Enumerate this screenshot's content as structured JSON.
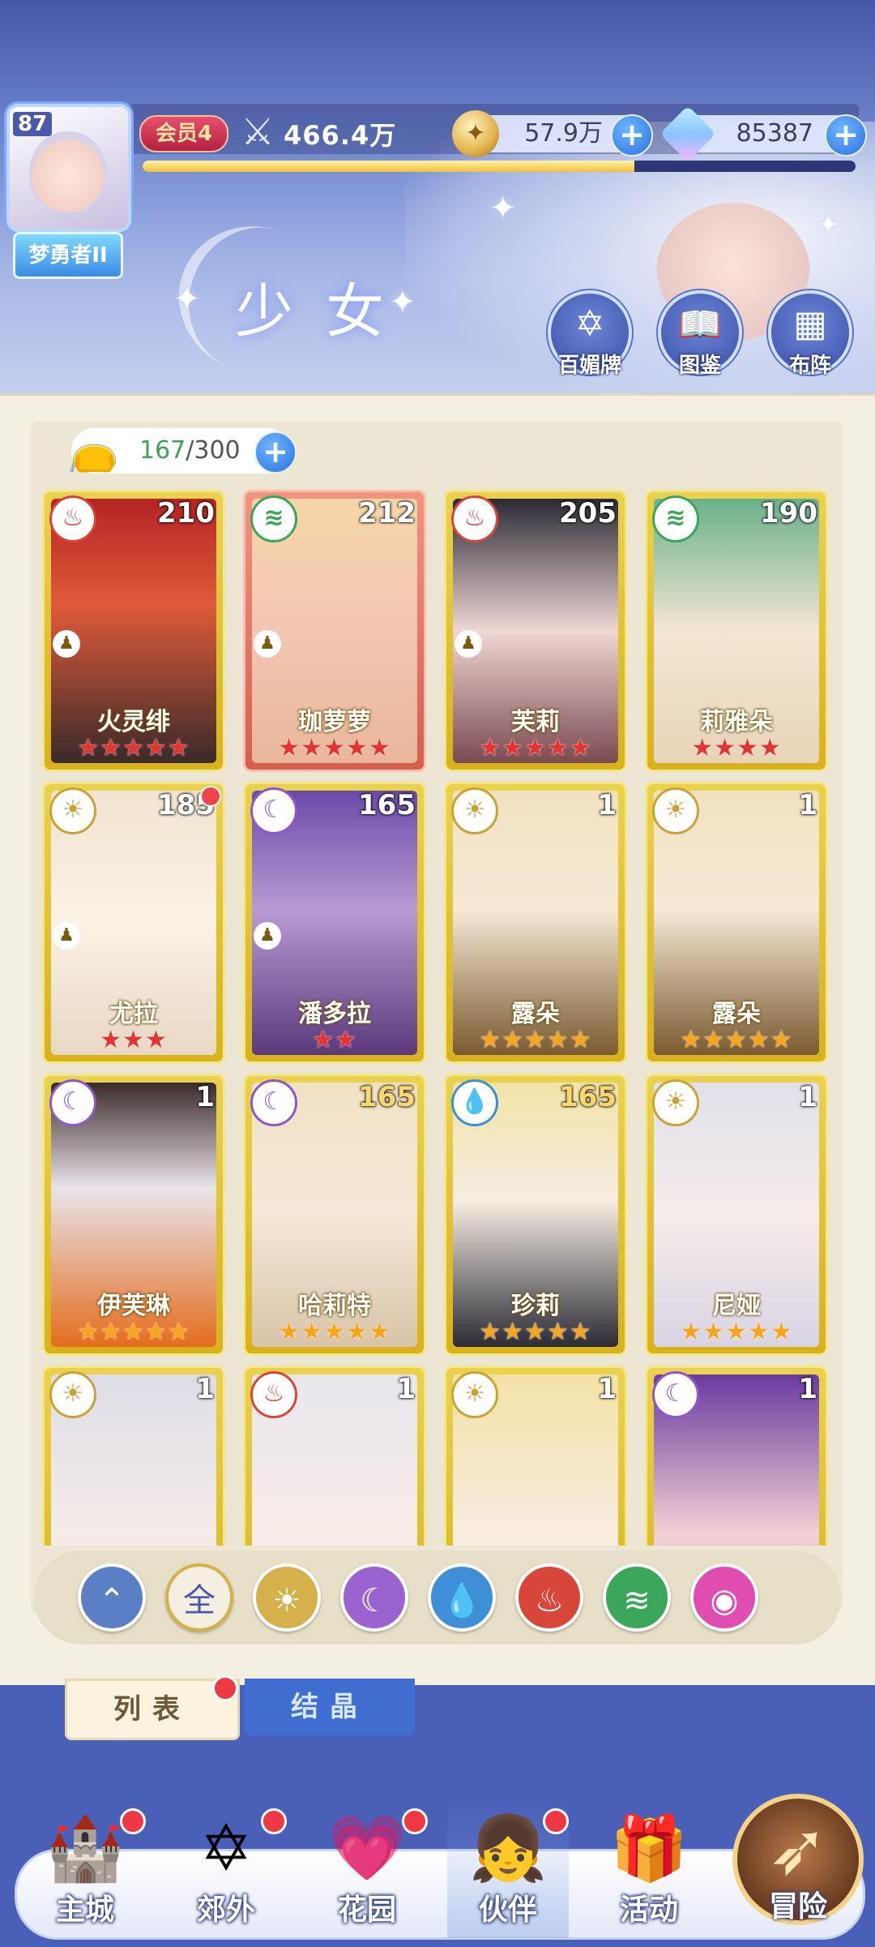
{
  "header": {
    "player_level": "87",
    "player_title": "梦勇者II",
    "vip": "会员4",
    "power": "466.4万",
    "gold": "57.9万",
    "gems": "85387",
    "exp_fraction": 0.69,
    "section_title": "少女",
    "buttons": [
      {
        "label": "百媚牌",
        "icon": "hexagram-card-icon"
      },
      {
        "label": "图鉴",
        "icon": "book-icon"
      },
      {
        "label": "布阵",
        "icon": "grid-formation-icon"
      }
    ]
  },
  "capacity": {
    "current": "167",
    "max": "/300"
  },
  "cards": [
    {
      "name": "火灵绯",
      "level": "210",
      "element": "fire",
      "stars": "★★★★★",
      "star_color": "red",
      "pink": false,
      "pawn": true,
      "dot": false
    },
    {
      "name": "珈萝萝",
      "level": "212",
      "element": "wind",
      "stars": "★★★★★",
      "star_color": "red",
      "pink": true,
      "pawn": true,
      "dot": false
    },
    {
      "name": "芙莉",
      "level": "205",
      "element": "fire",
      "stars": "★★★★★",
      "star_color": "red",
      "pink": false,
      "pawn": true,
      "dot": false
    },
    {
      "name": "莉雅朵",
      "level": "190",
      "element": "wind",
      "stars": "★★★★",
      "star_color": "red",
      "pink": false,
      "pawn": false,
      "dot": false
    },
    {
      "name": "尤拉",
      "level": "185",
      "element": "light",
      "stars": "★★★",
      "star_color": "red",
      "pink": false,
      "pawn": true,
      "dot": true
    },
    {
      "name": "潘多拉",
      "level": "165",
      "element": "moon",
      "stars": "★★",
      "star_color": "red",
      "pink": false,
      "pawn": true,
      "dot": false
    },
    {
      "name": "露朵",
      "level": "1",
      "element": "light",
      "stars": "★★★★★",
      "star_color": "gold",
      "pink": false,
      "pawn": false,
      "dot": false
    },
    {
      "name": "露朵",
      "level": "1",
      "element": "light",
      "stars": "★★★★★",
      "star_color": "gold",
      "pink": false,
      "pawn": false,
      "dot": false
    },
    {
      "name": "伊芙琳",
      "level": "1",
      "element": "moon",
      "stars": "★★★★★",
      "star_color": "gold",
      "pink": false,
      "pawn": false,
      "dot": false
    },
    {
      "name": "哈莉特",
      "level": "165",
      "element": "moon",
      "stars": "★★★★★",
      "star_color": "gold",
      "pink": false,
      "pawn": false,
      "dot": false,
      "gold_num": true
    },
    {
      "name": "珍莉",
      "level": "165",
      "element": "water",
      "stars": "★★★★★",
      "star_color": "gold",
      "pink": false,
      "pawn": false,
      "dot": false,
      "gold_num": true
    },
    {
      "name": "尼娅",
      "level": "1",
      "element": "light",
      "stars": "★★★★★",
      "star_color": "gold",
      "pink": false,
      "pawn": false,
      "dot": false
    },
    {
      "name": "",
      "level": "1",
      "element": "light",
      "stars": "",
      "star_color": "gold",
      "pink": false,
      "pawn": false,
      "dot": false
    },
    {
      "name": "",
      "level": "1",
      "element": "fire",
      "stars": "",
      "star_color": "gold",
      "pink": false,
      "pawn": false,
      "dot": false
    },
    {
      "name": "",
      "level": "1",
      "element": "light",
      "stars": "",
      "star_color": "gold",
      "pink": false,
      "pawn": false,
      "dot": false
    },
    {
      "name": "",
      "level": "1",
      "element": "moon",
      "stars": "",
      "star_color": "gold",
      "pink": false,
      "pawn": false,
      "dot": false
    }
  ],
  "filters": [
    {
      "key": "sort",
      "label": "",
      "icon": "sort-up-icon",
      "color": "#5a7fc4"
    },
    {
      "key": "all",
      "label": "全",
      "icon": "all-icon",
      "color": "#f4efe0"
    },
    {
      "key": "light",
      "label": "",
      "icon": "sun-icon",
      "color": "#d6b04a"
    },
    {
      "key": "moon",
      "label": "",
      "icon": "moon-icon",
      "color": "#9a63d0"
    },
    {
      "key": "water",
      "label": "",
      "icon": "water-drop-icon",
      "color": "#3e8fd6"
    },
    {
      "key": "fire",
      "label": "",
      "icon": "fire-icon",
      "color": "#d8463a"
    },
    {
      "key": "wind",
      "label": "",
      "icon": "wind-icon",
      "color": "#3aa65a"
    },
    {
      "key": "arcane",
      "label": "",
      "icon": "orb-icon",
      "color": "#e04cb0"
    }
  ],
  "tabs": {
    "list": "列表",
    "crystal": "结晶"
  },
  "nav": [
    {
      "label": "主城",
      "icon": "castle-icon",
      "dot": true
    },
    {
      "label": "郊外",
      "icon": "portal-icon",
      "dot": true
    },
    {
      "label": "花园",
      "icon": "heart-icon",
      "dot": true
    },
    {
      "label": "伙伴",
      "icon": "partner-icon",
      "dot": true,
      "active": true
    },
    {
      "label": "活动",
      "icon": "gift-icon",
      "dot": false
    },
    {
      "label": "冒险",
      "icon": "compass-icon",
      "dot": false
    }
  ],
  "colors": {
    "fire": "#d8463a",
    "wind": "#3aa65a",
    "light": "#c9a23a",
    "moon": "#8e58c8",
    "water": "#3e8fd6"
  }
}
